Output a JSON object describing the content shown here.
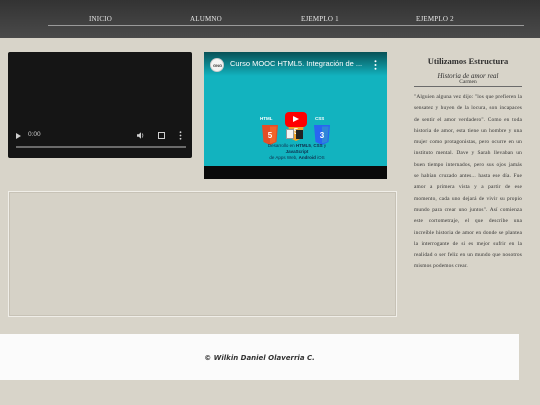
{
  "nav": {
    "items": [
      {
        "label": "INICIO"
      },
      {
        "label": "ALUMNO"
      },
      {
        "label": "EJEMPLO 1"
      },
      {
        "label": "EJEMPLO 2"
      }
    ]
  },
  "video_player": {
    "time": "0:00",
    "icons": [
      "play-icon",
      "volume-icon",
      "fullscreen-icon",
      "more-options-icon"
    ]
  },
  "youtube_embed": {
    "title": "Curso MOOC HTML5. Integración de ...",
    "channel_avatar_text": "GNG",
    "caption_line1": "Desarrollo en",
    "caption_bold1": "HTML5",
    "caption_mid": ", ",
    "caption_bold2": "CSS",
    "caption_and": " y ",
    "caption_bold3": "JavaScript",
    "caption_line2": "de Apps Web, ",
    "caption_bold4": "Android",
    "caption_ios": " iOS",
    "badges": [
      "HTML",
      "JS",
      "CSS"
    ],
    "colors": {
      "background": "#12b3bf",
      "play": "#ff0000",
      "html": "#e44d26",
      "js": "#f0a52c",
      "css": "#2965f1"
    }
  },
  "aside": {
    "title": "Utilizamos Estructura",
    "subtitle": "Historia de amor real",
    "subtitle_overlay": "Carmen",
    "body": "\"Alguien alguna vez dijo: \"los que prefieren la sensatez y huyen de la locura, son incapaces de sentir el amor verdadero\". Como en toda historia de amor, esta tiene un hombre y una mujer como protagonistas, pero ocurre en un instituto mental. Dave y Sarah llevaban un buen tiempo internados, pero sus ojos jamás se habían cruzado antes... hasta ese día. Fue amor a primera vista y a partir de ese momento, cada uno dejará de vivir su propio mundo para crear uno juntos\". Así comienza este cortometraje, el que describe una increíble historia de amor en donde se plantea la interrogante de si es mejor sufrir en la realidad o ser feliz en un mundo que nosotros mismos podemos crear."
  },
  "footer": {
    "text": "© Wilkin Daniel Olaverria C."
  }
}
